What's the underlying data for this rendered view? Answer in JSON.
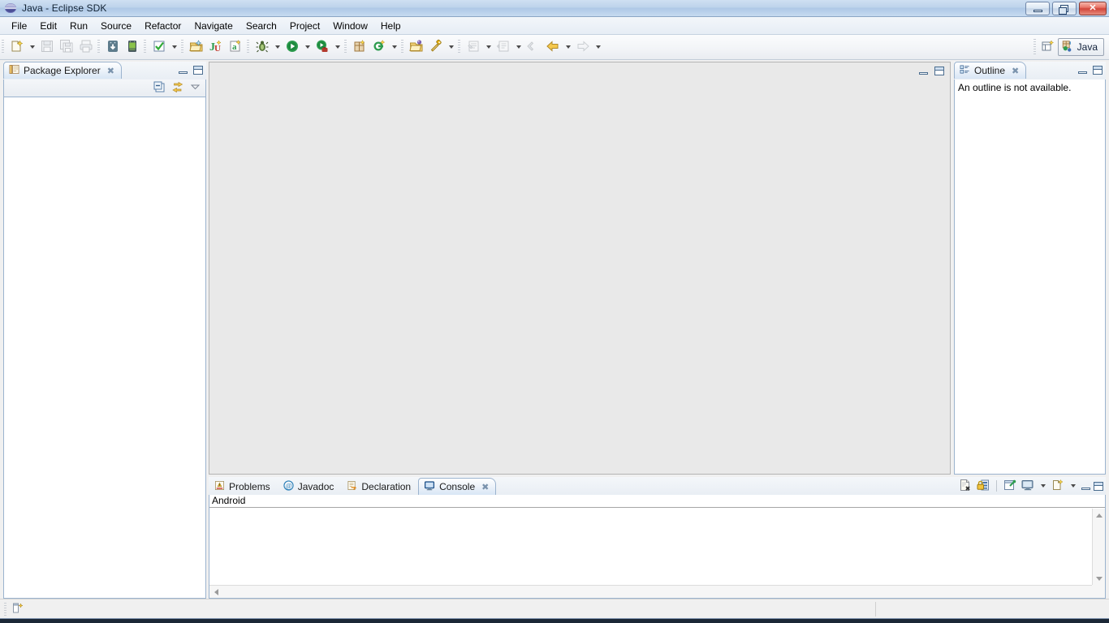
{
  "window": {
    "title": "Java - Eclipse SDK",
    "app_icon": "eclipse-icon",
    "buttons": {
      "minimize": "Minimize",
      "maximize": "Maximize",
      "close": "Close"
    }
  },
  "menubar": {
    "items": [
      {
        "label": "File"
      },
      {
        "label": "Edit"
      },
      {
        "label": "Run"
      },
      {
        "label": "Source"
      },
      {
        "label": "Refactor"
      },
      {
        "label": "Navigate"
      },
      {
        "label": "Search"
      },
      {
        "label": "Project"
      },
      {
        "label": "Window"
      },
      {
        "label": "Help"
      }
    ]
  },
  "toolbar": {
    "groups": [
      {
        "buttons": [
          {
            "icon": "new-wizard-icon",
            "title": "New",
            "dropdown": true
          },
          {
            "icon": "save-icon",
            "title": "Save",
            "disabled": true
          },
          {
            "icon": "save-all-icon",
            "title": "Save All",
            "disabled": true
          },
          {
            "icon": "print-icon",
            "title": "Print",
            "disabled": true
          }
        ]
      },
      {
        "buttons": [
          {
            "icon": "android-sdk-manager-icon",
            "title": "Android SDK Manager"
          },
          {
            "icon": "android-avd-manager-icon",
            "title": "Android Virtual Device Manager"
          }
        ]
      },
      {
        "buttons": [
          {
            "icon": "build-check-icon",
            "title": "Build",
            "dropdown": true
          }
        ]
      },
      {
        "buttons": [
          {
            "icon": "new-java-project-icon",
            "title": "New Java Project"
          },
          {
            "icon": "new-junit-test-icon",
            "title": "New JUnit Test Case"
          },
          {
            "icon": "new-annotation-icon",
            "title": "New Java Annotation"
          }
        ]
      },
      {
        "buttons": [
          {
            "icon": "debug-icon",
            "title": "Debug",
            "dropdown": true
          },
          {
            "icon": "run-icon",
            "title": "Run",
            "dropdown": true
          },
          {
            "icon": "run-external-tools-icon",
            "title": "External Tools",
            "dropdown": true
          }
        ]
      },
      {
        "buttons": [
          {
            "icon": "new-package-icon",
            "title": "New Package"
          },
          {
            "icon": "new-class-icon",
            "title": "New Java Class",
            "dropdown": true
          }
        ]
      },
      {
        "buttons": [
          {
            "icon": "open-type-icon",
            "title": "Open Type"
          },
          {
            "icon": "search-icon",
            "title": "Search",
            "dropdown": true
          }
        ]
      },
      {
        "buttons": [
          {
            "icon": "next-annotation-icon",
            "title": "Next Annotation",
            "dropdown": true,
            "disabled": true
          },
          {
            "icon": "previous-annotation-icon",
            "title": "Previous Annotation",
            "dropdown": true,
            "disabled": true
          }
        ]
      },
      {
        "buttons": [
          {
            "icon": "last-edit-location-icon",
            "title": "Last Edit Location",
            "disabled": true
          },
          {
            "icon": "back-icon",
            "title": "Back",
            "dropdown": true
          },
          {
            "icon": "forward-icon",
            "title": "Forward",
            "dropdown": true,
            "disabled": true
          }
        ]
      }
    ],
    "perspective": {
      "open_perspective_icon": "open-perspective-icon",
      "current_label": "Java",
      "current_icon": "java-perspective-icon"
    }
  },
  "package_explorer": {
    "tab_label": "Package Explorer",
    "tab_icon": "package-explorer-icon",
    "close_glyph": "✖",
    "toolbar": [
      {
        "icon": "collapse-all-icon",
        "title": "Collapse All"
      },
      {
        "icon": "link-with-editor-icon",
        "title": "Link with Editor"
      },
      {
        "icon": "view-menu-icon",
        "title": "View Menu"
      }
    ],
    "view_buttons": [
      {
        "icon": "minimize-icon",
        "title": "Minimize"
      },
      {
        "icon": "maximize-icon",
        "title": "Maximize"
      }
    ],
    "tree_items": []
  },
  "editor_area": {
    "empty": true,
    "view_buttons": [
      {
        "icon": "minimize-icon",
        "title": "Minimize"
      },
      {
        "icon": "maximize-icon",
        "title": "Maximize"
      }
    ]
  },
  "outline": {
    "tab_label": "Outline",
    "tab_icon": "outline-icon",
    "close_glyph": "✖",
    "message": "An outline is not available.",
    "view_buttons": [
      {
        "icon": "minimize-icon",
        "title": "Minimize"
      },
      {
        "icon": "maximize-icon",
        "title": "Maximize"
      }
    ]
  },
  "bottom_panel": {
    "tabs": [
      {
        "label": "Problems",
        "icon": "problems-icon",
        "active": false,
        "closeable": false
      },
      {
        "label": "Javadoc",
        "icon": "javadoc-icon",
        "active": false,
        "closeable": false
      },
      {
        "label": "Declaration",
        "icon": "declaration-icon",
        "active": false,
        "closeable": false
      },
      {
        "label": "Console",
        "icon": "console-icon",
        "active": true,
        "closeable": true
      }
    ],
    "close_glyph": "✖",
    "console": {
      "label": "Android",
      "content": ""
    },
    "toolbar": [
      {
        "icon": "clear-console-icon",
        "title": "Clear Console"
      },
      {
        "icon": "scroll-lock-icon",
        "title": "Scroll Lock"
      },
      {
        "icon": "pin-console-icon",
        "title": "Pin Console"
      },
      {
        "icon": "display-selected-console-icon",
        "title": "Display Selected Console",
        "dropdown": true
      },
      {
        "icon": "open-console-icon",
        "title": "Open Console",
        "dropdown": true
      }
    ],
    "view_buttons": [
      {
        "icon": "minimize-icon",
        "title": "Minimize"
      },
      {
        "icon": "maximize-icon",
        "title": "Maximize"
      }
    ]
  },
  "statusbar": {
    "icon": "writable-indicator-icon",
    "text": ""
  },
  "colors": {
    "titlebar_top": "#cfe0f2",
    "titlebar_bottom": "#aec8e6",
    "close_button": "#d1453a",
    "active_tab_border": "#9bb3ce",
    "editor_background": "#e9e9e9",
    "panel_background": "#f0f0f0",
    "taskbar": "#1b2736"
  }
}
